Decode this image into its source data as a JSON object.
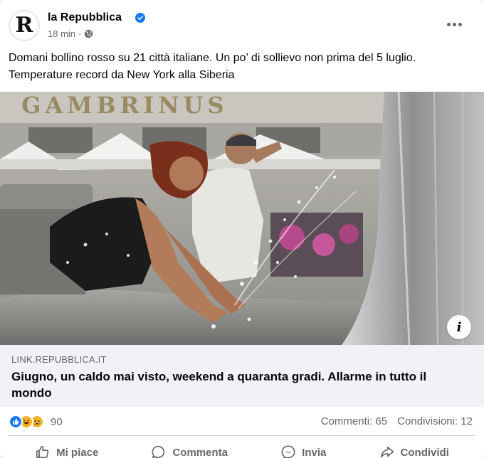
{
  "post": {
    "page_name": "la Repubblica",
    "avatar_letter": "R",
    "time": "18 min",
    "separator": "·",
    "text_line1": "Domani bollino rosso su 21 città italiane. Un po’ di sollievo non prima del 5 luglio.",
    "text_line2": "Temperature record da New York alla Siberia"
  },
  "image": {
    "sign_text": "GAMBRINUS",
    "info_label": "i"
  },
  "link": {
    "domain": "LINK.REPUBBLICA.IT",
    "title": "Giugno, un caldo mai visto, weekend a quaranta gradi. Allarme in tutto il mondo"
  },
  "stats": {
    "reaction_count": "90",
    "comments": "Commenti: 65",
    "shares": "Condivisioni: 12"
  },
  "actions": {
    "like": "Mi piace",
    "comment": "Commenta",
    "send": "Invia",
    "share": "Condividi"
  },
  "colors": {
    "verified": "#1877f2",
    "like_reaction": "#1877f2",
    "haha_reaction": "#f7b125",
    "text_secondary": "#65676b"
  }
}
